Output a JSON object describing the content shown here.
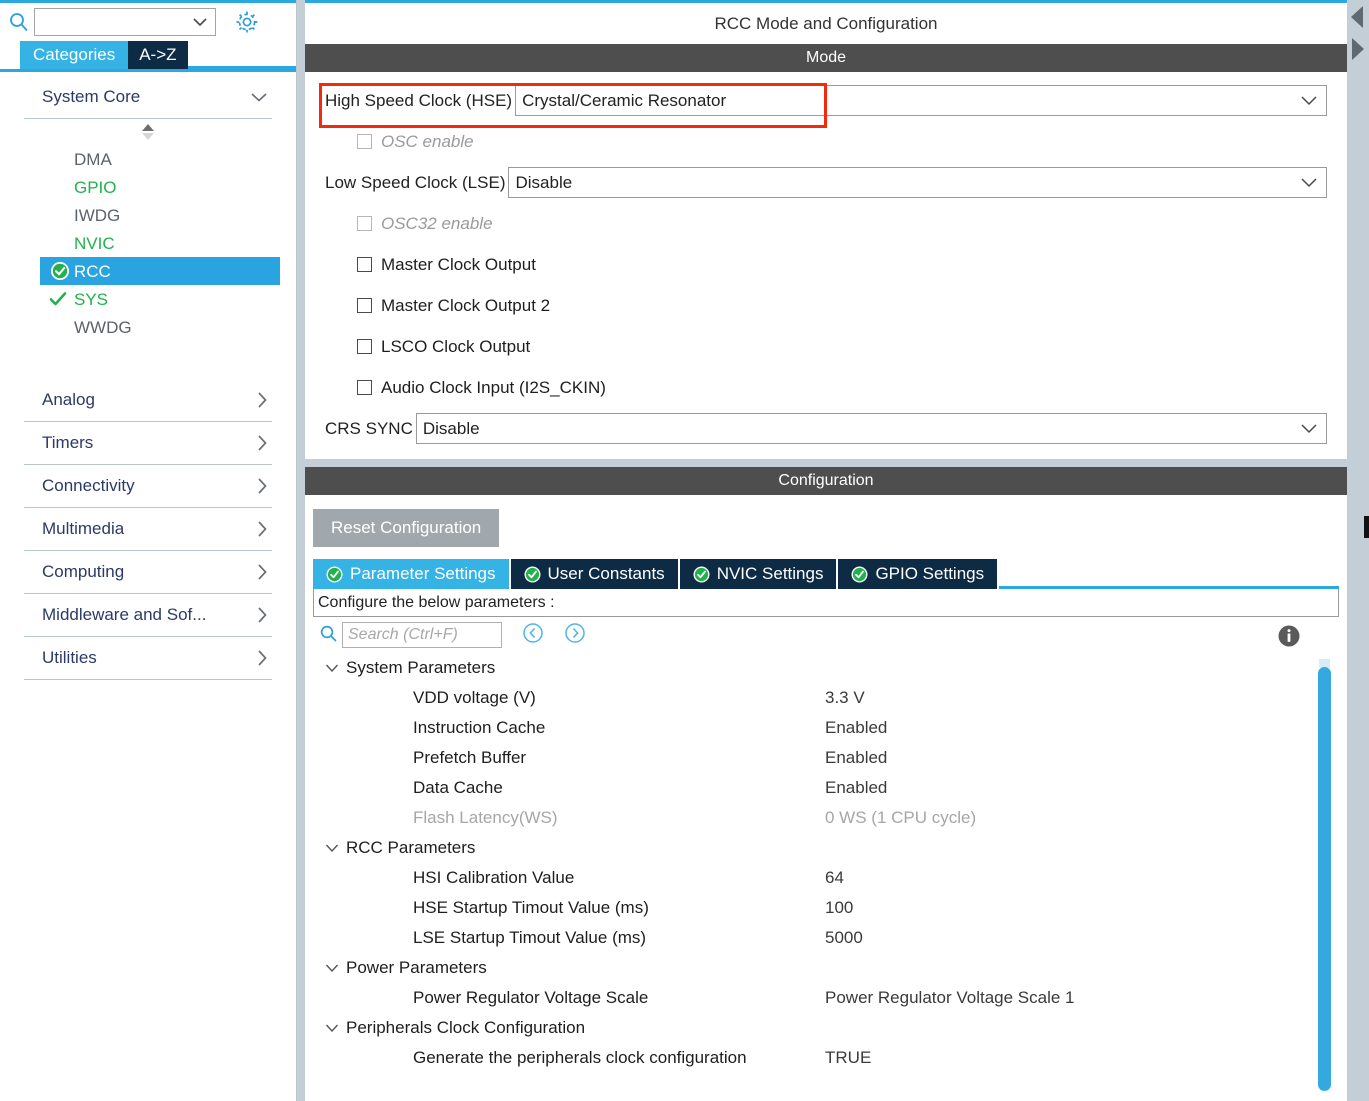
{
  "sidebar": {
    "search": {
      "value": "",
      "placeholder": ""
    },
    "icons": {
      "search": "search-icon",
      "gear": "gear-icon",
      "dropdown": "chevron-down-icon"
    },
    "tabs": [
      {
        "label": "Categories",
        "active": true
      },
      {
        "label": "A->Z",
        "active": false
      }
    ],
    "groups": [
      {
        "label": "System Core",
        "expanded": true,
        "items": [
          {
            "label": "DMA",
            "state": "grey",
            "selected": false,
            "mark": "none"
          },
          {
            "label": "GPIO",
            "state": "green",
            "selected": false,
            "mark": "none"
          },
          {
            "label": "IWDG",
            "state": "grey",
            "selected": false,
            "mark": "none"
          },
          {
            "label": "NVIC",
            "state": "green",
            "selected": false,
            "mark": "none"
          },
          {
            "label": "RCC",
            "state": "selected",
            "selected": true,
            "mark": "check-circle-icon"
          },
          {
            "label": "SYS",
            "state": "green",
            "selected": false,
            "mark": "check-icon"
          },
          {
            "label": "WWDG",
            "state": "grey",
            "selected": false,
            "mark": "none"
          }
        ]
      },
      {
        "label": "Analog",
        "expanded": false,
        "items": []
      },
      {
        "label": "Timers",
        "expanded": false,
        "items": []
      },
      {
        "label": "Connectivity",
        "expanded": false,
        "items": []
      },
      {
        "label": "Multimedia",
        "expanded": false,
        "items": []
      },
      {
        "label": "Computing",
        "expanded": false,
        "items": []
      },
      {
        "label": "Middleware and Sof...",
        "expanded": false,
        "items": []
      },
      {
        "label": "Utilities",
        "expanded": false,
        "items": []
      }
    ]
  },
  "panel": {
    "title": "RCC Mode and Configuration",
    "mode_header": "Mode",
    "config_header": "Configuration"
  },
  "mode": {
    "hse": {
      "label": "High Speed Clock (HSE)",
      "value": "Crystal/Ceramic Resonator",
      "highlighted": true
    },
    "osc_enable": {
      "label": "OSC enable",
      "checked": false,
      "disabled": true
    },
    "lse": {
      "label": "Low Speed Clock (LSE)",
      "value": "Disable"
    },
    "osc32_enable": {
      "label": "OSC32 enable",
      "checked": false,
      "disabled": true
    },
    "checkboxes": [
      {
        "label": "Master Clock Output",
        "checked": false,
        "disabled": false
      },
      {
        "label": "Master Clock Output 2",
        "checked": false,
        "disabled": false
      },
      {
        "label": "LSCO Clock Output",
        "checked": false,
        "disabled": false
      },
      {
        "label": "Audio Clock Input (I2S_CKIN)",
        "checked": false,
        "disabled": false
      }
    ],
    "crs_sync": {
      "label": "CRS SYNC",
      "value": "Disable"
    }
  },
  "config": {
    "reset_button": "Reset Configuration",
    "tabs": [
      {
        "label": "Parameter Settings",
        "active": true
      },
      {
        "label": "User Constants",
        "active": false
      },
      {
        "label": "NVIC Settings",
        "active": false
      },
      {
        "label": "GPIO Settings",
        "active": false
      }
    ],
    "hint": "Configure the below parameters :",
    "search": {
      "value": "",
      "placeholder": "Search (Ctrl+F)"
    },
    "nav_prev_icon": "chevron-left-circle-icon",
    "nav_next_icon": "chevron-right-circle-icon",
    "info_icon": "info-icon",
    "groups": [
      {
        "label": "System Parameters",
        "expanded": true,
        "rows": [
          {
            "name": "VDD voltage (V)",
            "value": "3.3 V",
            "disabled": false
          },
          {
            "name": "Instruction Cache",
            "value": "Enabled",
            "disabled": false
          },
          {
            "name": "Prefetch Buffer",
            "value": "Enabled",
            "disabled": false
          },
          {
            "name": "Data Cache",
            "value": "Enabled",
            "disabled": false
          },
          {
            "name": "Flash Latency(WS)",
            "value": "0 WS (1 CPU cycle)",
            "disabled": true
          }
        ]
      },
      {
        "label": "RCC Parameters",
        "expanded": true,
        "rows": [
          {
            "name": "HSI Calibration Value",
            "value": "64",
            "disabled": false
          },
          {
            "name": "HSE Startup Timout Value (ms)",
            "value": "100",
            "disabled": false
          },
          {
            "name": "LSE Startup Timout Value (ms)",
            "value": "5000",
            "disabled": false
          }
        ]
      },
      {
        "label": "Power Parameters",
        "expanded": true,
        "rows": [
          {
            "name": "Power Regulator Voltage Scale",
            "value": "Power Regulator Voltage Scale 1",
            "disabled": false
          }
        ]
      },
      {
        "label": "Peripherals Clock Configuration",
        "expanded": true,
        "rows": [
          {
            "name": "Generate the peripherals clock configuration",
            "value": "TRUE",
            "disabled": false
          }
        ]
      }
    ]
  },
  "colors": {
    "accent_blue": "#2ca8e0",
    "tab_active": "#34b3e4",
    "tab_inactive": "#0d2b45",
    "section_bar": "#4e4e4e",
    "selected_row": "#29a4e0",
    "green": "#22b14c",
    "highlight_red": "#f42b0b",
    "scrollbar": "#33a9e0"
  }
}
